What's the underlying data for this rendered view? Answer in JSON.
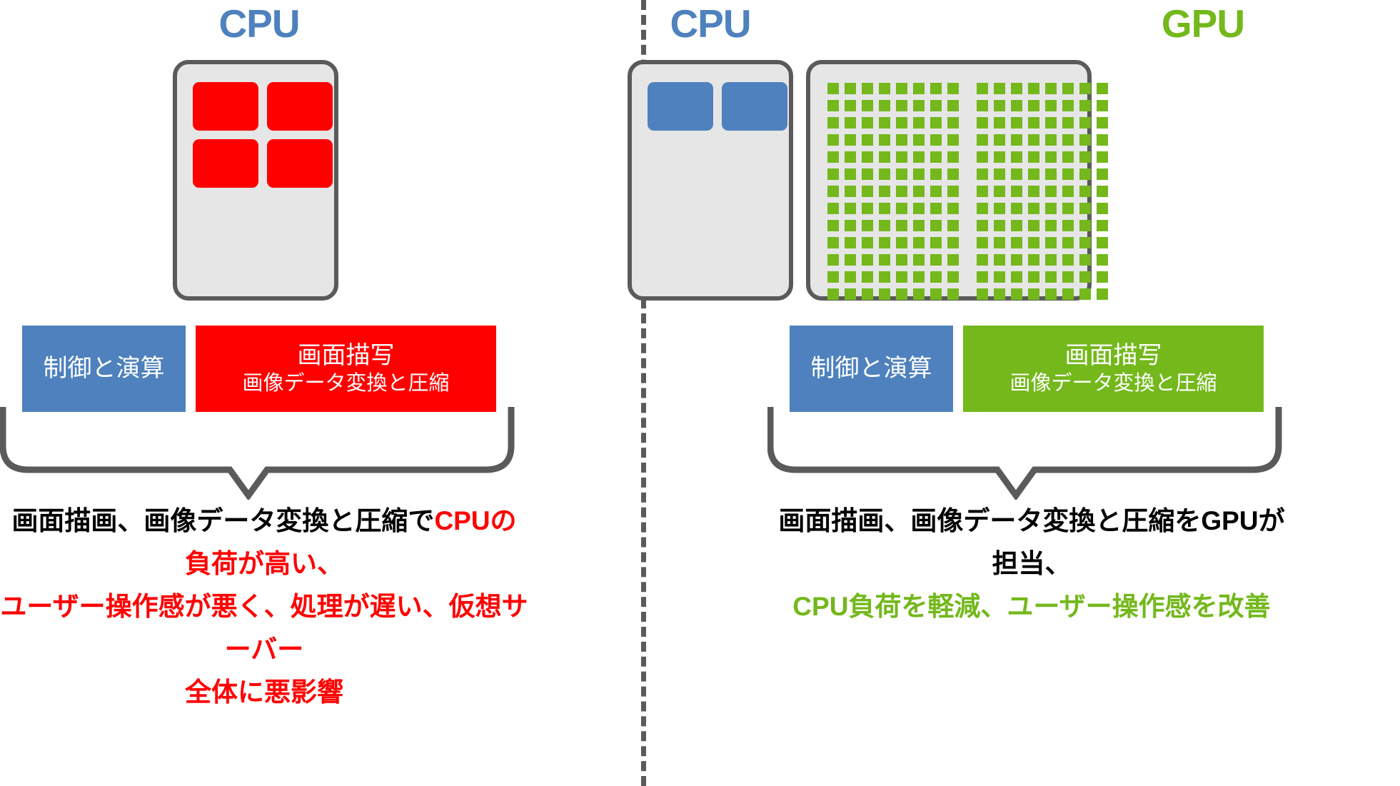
{
  "divider": {
    "style": "dashed-vertical",
    "color": "#5a5a5a"
  },
  "colors": {
    "blue": "#4e81bd",
    "green": "#74b81c",
    "red": "#fe0000",
    "chip_fill": "#e6e6e6",
    "chip_border": "#5a5a5a",
    "black": "#000000"
  },
  "left_panel": {
    "heading": "CPU",
    "chip": {
      "cores": 4,
      "core_color": "#fe0000"
    },
    "roles": [
      {
        "main": "制御と演算",
        "sub": "",
        "color": "#4e81bd"
      },
      {
        "main": "画面描写",
        "sub": "画像データ変換と圧縮",
        "color": "#fe0000"
      }
    ],
    "caption": {
      "normal_1": "画面描画、画像データ変換と圧縮で",
      "accent_1": "CPUの負荷が高い、",
      "accent_2": "ユーザー操作感が悪く、処理が遅い、仮想サーバー",
      "accent_3": "全体に悪影響"
    }
  },
  "right_panel": {
    "heading_cpu": "CPU",
    "heading_gpu": "GPU",
    "cpu_chip": {
      "cores": 2,
      "core_color": "#4e81bd"
    },
    "gpu_chip": {
      "grid_rows": 13,
      "grid_cols": 16,
      "cell_color": "#74b81c"
    },
    "roles": [
      {
        "main": "制御と演算",
        "sub": "",
        "color": "#4e81bd"
      },
      {
        "main": "画面描写",
        "sub": "画像データ変換と圧縮",
        "color": "#74b81c"
      }
    ],
    "caption": {
      "normal_1": "画面描画、画像データ変換と圧縮をGPUが担当、",
      "accent_1": "CPU負荷を軽減、ユーザー操作感を改善"
    }
  }
}
